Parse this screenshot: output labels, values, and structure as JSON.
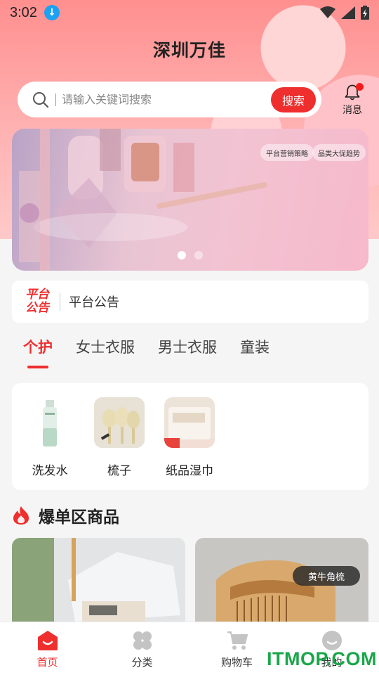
{
  "status_bar": {
    "time": "3:02"
  },
  "header": {
    "title": "深圳万佳"
  },
  "search": {
    "placeholder": "请输入关键词搜索",
    "button_label": "搜索"
  },
  "messages": {
    "label": "消息"
  },
  "banner": {
    "tags": [
      "平台营销策略",
      "品类大促趋势"
    ],
    "active_index": 0,
    "count": 2
  },
  "notice": {
    "logo_line1": "平台",
    "logo_line2": "公告",
    "text": "平台公告"
  },
  "tabs": [
    {
      "label": "个护",
      "active": true
    },
    {
      "label": "女士衣服",
      "active": false
    },
    {
      "label": "男士衣服",
      "active": false
    },
    {
      "label": "童装",
      "active": false
    }
  ],
  "categories": [
    {
      "label": "洗发水",
      "icon": "shampoo-bottle"
    },
    {
      "label": "梳子",
      "icon": "combs"
    },
    {
      "label": "纸品湿巾",
      "icon": "tissue-pack"
    }
  ],
  "hot_section": {
    "title": "爆单区商品"
  },
  "products": [
    {
      "tag": "",
      "image": "tissue-bag"
    },
    {
      "tag": "黄牛角梳",
      "image": "horn-comb"
    }
  ],
  "bottom_nav": [
    {
      "label": "首页",
      "icon": "home-icon",
      "active": true
    },
    {
      "label": "分类",
      "icon": "category-icon",
      "active": false
    },
    {
      "label": "购物车",
      "icon": "cart-icon",
      "active": false
    },
    {
      "label": "我的",
      "icon": "profile-icon",
      "active": false
    }
  ],
  "watermark": "ITMOP.COM",
  "colors": {
    "accent": "#ef2e2e",
    "header_gradient_top": "#ff8f8f",
    "watermark": "#1aa64a"
  }
}
